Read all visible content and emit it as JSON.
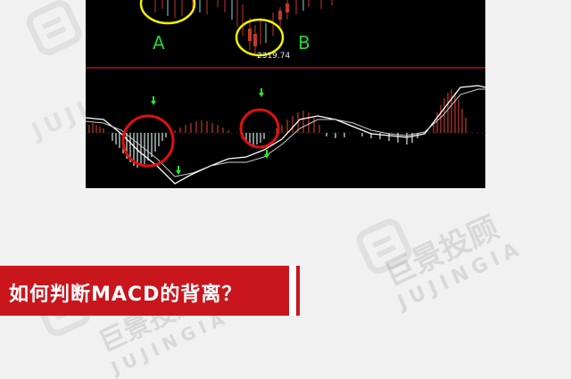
{
  "chart": {
    "label_a": "A",
    "label_b": "B",
    "price_value": "2319.74"
  },
  "title": {
    "text": "如何判断MACD的背离？"
  },
  "watermark": {
    "text_cn": "巨景投顾",
    "text_en": "JUJINGIA"
  },
  "colors": {
    "accent_red": "#c9161d",
    "circle_yellow": "#f3f000",
    "circle_red": "#e01010",
    "label_green": "#23d23a",
    "arrow_green": "#22ee22",
    "bar_red": "#c0392b"
  }
}
